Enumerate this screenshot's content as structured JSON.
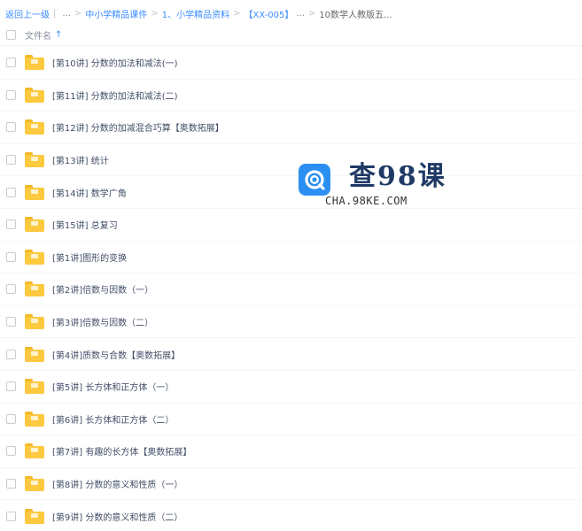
{
  "breadcrumb": {
    "back": "返回上一级",
    "items": [
      "中小学精品课件",
      "1、小学精品资料",
      "【XX-005】",
      "10数学人教版五..."
    ]
  },
  "header": {
    "name_column": "文件名"
  },
  "files": [
    "[第10讲] 分数的加法和减法(一)",
    "[第11讲] 分数的加法和减法(二)",
    "[第12讲] 分数的加减混合巧算【奥数拓展】",
    "[第13讲] 统计",
    "[第14讲] 数学广角",
    "[第15讲] 总复习",
    "[第1讲]图形的变换",
    "[第2讲]倍数与因数（一）",
    "[第3讲]倍数与因数（二）",
    "[第4讲]质数与合数【奥数拓展】",
    "[第5讲] 长方体和正方体（一）",
    "[第6讲] 长方体和正方体（二）",
    "[第7讲] 有趣的长方体【奥数拓展】",
    "[第8讲] 分数的意义和性质（一）",
    "[第9讲] 分数的意义和性质（二）"
  ],
  "watermark": {
    "title": "查98课",
    "url": "CHA.98KE.COM"
  },
  "colors": {
    "link": "#3b8cff",
    "folder": "#fcc93f",
    "text": "#424e67",
    "logo": "#2b8ff2"
  }
}
